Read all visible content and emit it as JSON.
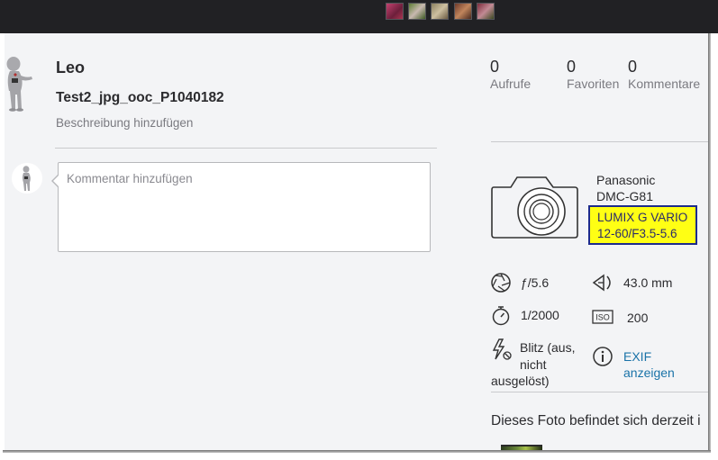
{
  "topbar": {
    "thumbnails": [
      "photo-thumbnail-1",
      "photo-thumbnail-2",
      "photo-thumbnail-3",
      "photo-thumbnail-4",
      "photo-thumbnail-5"
    ]
  },
  "owner": {
    "name": "Leo",
    "avatar_icon": "person-figure-avatar"
  },
  "photo": {
    "title": "Test2_jpg_ooc_P1040182",
    "add_description": "Beschreibung hinzufügen"
  },
  "comment": {
    "placeholder": "Kommentar hinzufügen"
  },
  "stats": {
    "views": {
      "value": "0",
      "label": "Aufrufe"
    },
    "faves": {
      "value": "0",
      "label": "Favoriten"
    },
    "comments": {
      "value": "0",
      "label": "Kommentare"
    }
  },
  "camera": {
    "icon": "camera-icon",
    "make": "Panasonic",
    "model": "DMC-G81",
    "lens_line1": "LUMIX G VARIO",
    "lens_line2": "12-60/F3.5-5.6",
    "highlight_color": "#ffff14"
  },
  "exif": {
    "aperture": {
      "icon": "aperture-icon",
      "value": "ƒ/5.6"
    },
    "focal_length": {
      "icon": "focal-length-icon",
      "value": "43.0 mm"
    },
    "shutter": {
      "icon": "stopwatch-icon",
      "value": "1/2000"
    },
    "iso": {
      "icon": "iso-icon",
      "label": "ISO",
      "value": "200"
    },
    "flash": {
      "icon": "flash-off-icon",
      "line1": "Blitz (aus,",
      "line2": "nicht",
      "line3": "ausgelöst)"
    },
    "info": {
      "icon": "info-icon",
      "link_line1": "EXIF",
      "link_line2": "anzeigen"
    },
    "link_color": "#1a73a8"
  },
  "groups": {
    "note": "Dieses Foto befindet sich derzeit i"
  }
}
